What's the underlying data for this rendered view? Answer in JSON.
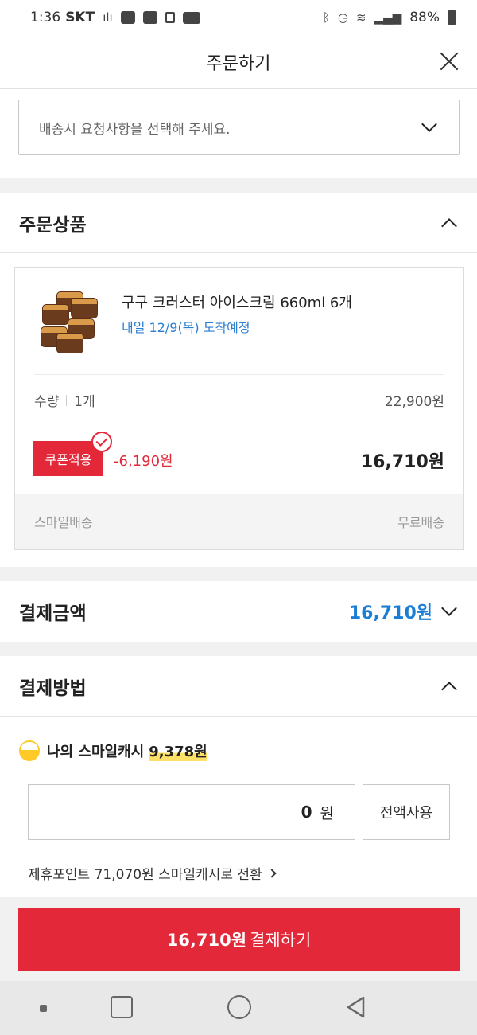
{
  "status_bar": {
    "time": "1:36",
    "carrier": "SKT",
    "battery": "88%"
  },
  "header": {
    "title": "주문하기"
  },
  "delivery_request": {
    "placeholder": "배송시 요청사항을 선택해 주세요."
  },
  "order_items": {
    "title": "주문상품",
    "product": {
      "name": "구구 크러스터 아이스크림 660ml 6개",
      "eta": "내일 12/9(목) 도착예정",
      "qty_label": "수량",
      "qty_value": "1개",
      "original_price": "22,900원",
      "coupon_label": "쿠폰적용",
      "discount": "-6,190원",
      "final_price": "16,710원",
      "shipping_type": "스마일배송",
      "shipping_fee": "무료배송"
    }
  },
  "payment_amount": {
    "title": "결제금액",
    "total": "16,710원"
  },
  "payment_method": {
    "title": "결제방법",
    "smile_cash_label": "나의 스마일캐시",
    "smile_cash_amount": "9,378원",
    "input_value": "0",
    "input_unit": "원",
    "use_all_label": "전액사용",
    "convert_link": "제휴포인트 71,070원 스마일캐시로 전환"
  },
  "pay_button": {
    "amount": "16,710원",
    "label": "결제하기"
  },
  "colors": {
    "accent_red": "#e3283a",
    "link_blue": "#2a7ed3",
    "cash_yellow": "#ffc928"
  }
}
